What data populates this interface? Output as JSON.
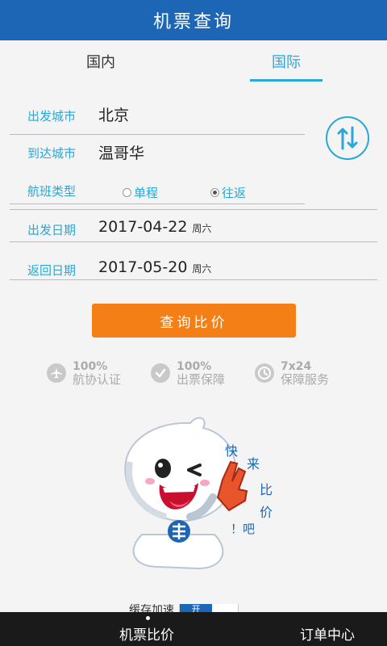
{
  "header": {
    "title": "机票查询"
  },
  "tabs": [
    {
      "label": "国内",
      "active": false
    },
    {
      "label": "国际",
      "active": true
    }
  ],
  "form": {
    "departure": {
      "label": "出发城市",
      "value": "北京"
    },
    "arrival": {
      "label": "到达城市",
      "value": "温哥华"
    },
    "flight_type": {
      "label": "航班类型",
      "options": [
        {
          "label": "单程",
          "selected": false
        },
        {
          "label": "往返",
          "selected": true
        }
      ]
    },
    "depart_date": {
      "label": "出发日期",
      "value": "2017-04-22",
      "weekday": "周六"
    },
    "return_date": {
      "label": "返回日期",
      "value": "2017-05-20",
      "weekday": "周六"
    }
  },
  "search_button": {
    "label": "查询比价"
  },
  "guarantees": [
    {
      "icon": "airplane-icon",
      "percent": "100%",
      "text": "航协认证"
    },
    {
      "icon": "check-icon",
      "percent": "100%",
      "text": "出票保障"
    },
    {
      "icon": "clock-icon",
      "percent": "7x24",
      "text": "保障服务"
    }
  ],
  "mascot": {
    "slogan": [
      "快",
      "来",
      "比",
      "价",
      "！吧"
    ]
  },
  "cache": {
    "label": "缓存加速",
    "toggle": "开"
  },
  "bottom_nav": [
    {
      "label": "机票比价",
      "active": true
    },
    {
      "label": "订单中心",
      "active": false
    }
  ],
  "colors": {
    "header": "#1c66b5",
    "accent": "#2aa7d6",
    "button": "#f57f17"
  }
}
